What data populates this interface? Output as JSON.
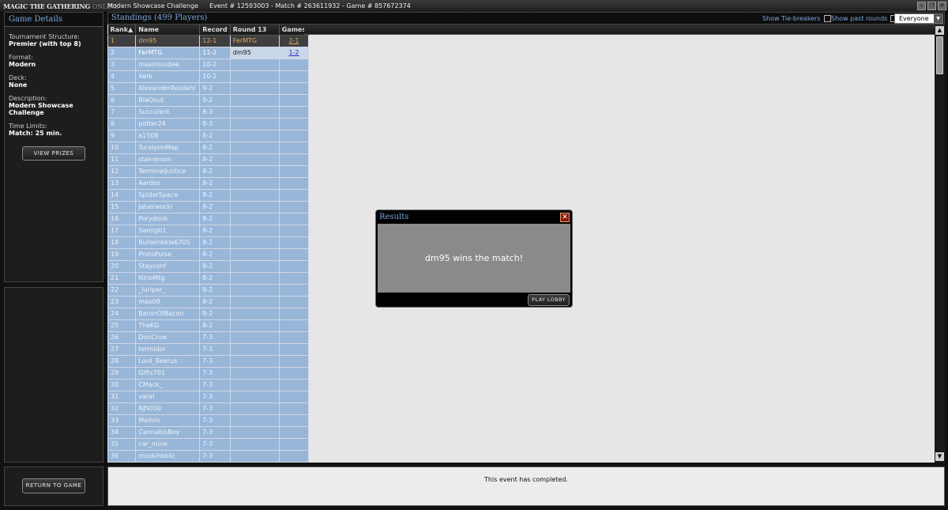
{
  "titlebar": {
    "logo_main": "MAGIC THE GATHERING",
    "logo_sub": "ONLINE",
    "event_name": "Modern Showcase Challenge",
    "event_ids": "Event # 12593003 - Match # 263611932 - Game # 857672374"
  },
  "game_details": {
    "heading": "Game Details",
    "fields": [
      {
        "label": "Tournament Structure:",
        "value": "Premier (with top 8)"
      },
      {
        "label": "Format:",
        "value": "Modern"
      },
      {
        "label": "Deck:",
        "value": "None"
      },
      {
        "label": "Description:",
        "value": "Modern Showcase Challenge"
      },
      {
        "label": "Time Limits:",
        "value": "Match: 25 min."
      }
    ],
    "view_prizes": "VIEW PRIZES",
    "return_to_game": "RETURN TO GAME"
  },
  "standings": {
    "title": "Standings (499 Players)",
    "show_tiebreakers": "Show Tie-breakers",
    "show_past_rounds": "Show past rounds",
    "filter_value": "Everyone",
    "columns": [
      "Rank▲",
      "Name",
      "Record",
      "Round 13",
      "Games"
    ],
    "rows": [
      {
        "rank": "1",
        "name": "dm95",
        "record": "12-1",
        "opponent": "FerMTG",
        "games": "2-1"
      },
      {
        "rank": "2",
        "name": "FerMTG",
        "record": "11-2",
        "opponent": "dm95",
        "games": "1-2"
      },
      {
        "rank": "3",
        "name": "maximusdee",
        "record": "10-2",
        "opponent": "",
        "games": ""
      },
      {
        "rank": "4",
        "name": "Xerk",
        "record": "10-2",
        "opponent": "",
        "games": ""
      },
      {
        "rank": "5",
        "name": "AlexanderRosdahl",
        "record": "9-2",
        "opponent": "",
        "games": ""
      },
      {
        "rank": "6",
        "name": "BlaQout",
        "record": "9-2",
        "opponent": "",
        "games": ""
      },
      {
        "rank": "7",
        "name": "Succulent",
        "record": "8-3",
        "opponent": "",
        "games": ""
      },
      {
        "rank": "8",
        "name": "potter24",
        "record": "8-3",
        "opponent": "",
        "games": ""
      },
      {
        "rank": "9",
        "name": "a1508",
        "record": "8-2",
        "opponent": "",
        "games": ""
      },
      {
        "rank": "10",
        "name": "TuralyonMap",
        "record": "8-2",
        "opponent": "",
        "games": ""
      },
      {
        "rank": "11",
        "name": "stainerson",
        "record": "8-2",
        "opponent": "",
        "games": ""
      },
      {
        "rank": "12",
        "name": "TerminalJustice",
        "record": "8-2",
        "opponent": "",
        "games": ""
      },
      {
        "rank": "13",
        "name": "Aardos",
        "record": "8-2",
        "opponent": "",
        "games": ""
      },
      {
        "rank": "14",
        "name": "SpiderSpace",
        "record": "8-2",
        "opponent": "",
        "games": ""
      },
      {
        "rank": "15",
        "name": "Jaberwocki",
        "record": "8-2",
        "opponent": "",
        "games": ""
      },
      {
        "rank": "16",
        "name": "Porydonk",
        "record": "8-2",
        "opponent": "",
        "games": ""
      },
      {
        "rank": "17",
        "name": "Samlg01",
        "record": "8-2",
        "opponent": "",
        "games": ""
      },
      {
        "rank": "18",
        "name": "Bullwinkkle6705",
        "record": "8-2",
        "opponent": "",
        "games": ""
      },
      {
        "rank": "19",
        "name": "ProtoPulse",
        "record": "8-2",
        "opponent": "",
        "games": ""
      },
      {
        "rank": "20",
        "name": "Stayconf",
        "record": "8-2",
        "opponent": "",
        "games": ""
      },
      {
        "rank": "21",
        "name": "NinoMtg",
        "record": "8-2",
        "opponent": "",
        "games": ""
      },
      {
        "rank": "22",
        "name": "_Iuriper_",
        "record": "8-2",
        "opponent": "",
        "games": ""
      },
      {
        "rank": "23",
        "name": "max09",
        "record": "8-2",
        "opponent": "",
        "games": ""
      },
      {
        "rank": "24",
        "name": "BaronOfBacon",
        "record": "8-2",
        "opponent": "",
        "games": ""
      },
      {
        "rank": "25",
        "name": "TheKG",
        "record": "8-2",
        "opponent": "",
        "games": ""
      },
      {
        "rank": "26",
        "name": "DonCrow",
        "record": "7-3",
        "opponent": "",
        "games": ""
      },
      {
        "rank": "27",
        "name": "termidor",
        "record": "7-3",
        "opponent": "",
        "games": ""
      },
      {
        "rank": "28",
        "name": "Lord_Beerus",
        "record": "7-3",
        "opponent": "",
        "games": ""
      },
      {
        "rank": "29",
        "name": "Gifts701",
        "record": "7-3",
        "opponent": "",
        "games": ""
      },
      {
        "rank": "30",
        "name": "CMack_",
        "record": "7-3",
        "opponent": "",
        "games": ""
      },
      {
        "rank": "31",
        "name": "varal",
        "record": "7-3",
        "opponent": "",
        "games": ""
      },
      {
        "rank": "32",
        "name": "NJS030",
        "record": "7-3",
        "opponent": "",
        "games": ""
      },
      {
        "rank": "33",
        "name": "Mallols",
        "record": "7-3",
        "opponent": "",
        "games": ""
      },
      {
        "rank": "34",
        "name": "CannabisBoy",
        "record": "7-3",
        "opponent": "",
        "games": ""
      },
      {
        "rank": "35",
        "name": "car_mine",
        "record": "7-3",
        "opponent": "",
        "games": ""
      },
      {
        "rank": "36",
        "name": "msskinbolic",
        "record": "7-3",
        "opponent": "",
        "games": ""
      }
    ]
  },
  "dialog": {
    "title": "Results",
    "message": "dm95 wins the match!",
    "button": "PLAY LOBBY"
  },
  "status_message": "This event has completed.",
  "colors": {
    "accent_blue": "#7aa7dc",
    "row_blue": "#98b6d8",
    "highlight_orange": "#e0a868"
  }
}
